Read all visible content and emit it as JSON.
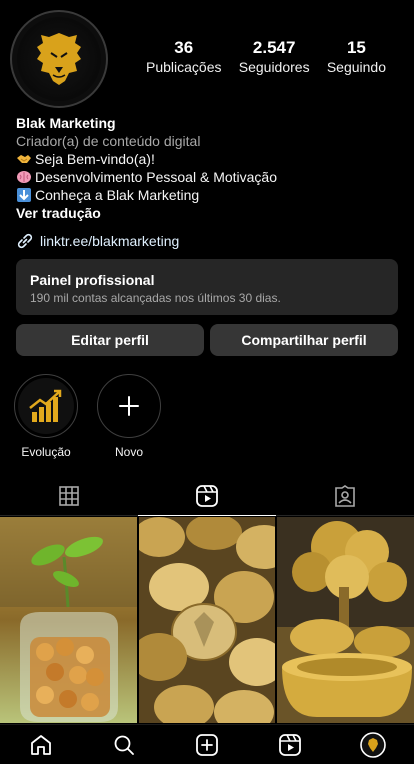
{
  "profile": {
    "stats": [
      {
        "value": "36",
        "label": "Publicações"
      },
      {
        "value": "2.547",
        "label": "Seguidores"
      },
      {
        "value": "15",
        "label": "Seguindo"
      }
    ]
  },
  "bio": {
    "name": "Blak Marketing",
    "category": "Criador(a) de conteúdo digital",
    "lines": [
      {
        "emoji": "handshake-emoji",
        "text": "Seja Bem-vindo(a)!"
      },
      {
        "emoji": "brain-emoji",
        "text": "Desenvolvimento Pessoal & Motivação"
      },
      {
        "emoji": "down-arrow-emoji",
        "text": "Conheça a Blak Marketing"
      }
    ],
    "translate": "Ver tradução",
    "link": "linktr.ee/blakmarketing"
  },
  "panel": {
    "title": "Painel profissional",
    "subtitle": "190 mil contas alcançadas nos últimos 30 dias."
  },
  "actions": {
    "edit": "Editar perfil",
    "share": "Compartilhar perfil"
  },
  "highlights": [
    {
      "label": "Evolução",
      "icon": "growth-chart-icon"
    },
    {
      "label": "Novo",
      "icon": "plus-icon"
    }
  ],
  "tabs": [
    "grid-icon",
    "reels-icon",
    "tagged-icon"
  ],
  "posts": [
    "plant-coins-jar",
    "gold-coins-pile",
    "money-tree-gold-pots"
  ],
  "nav": [
    "home-icon",
    "search-icon",
    "create-icon",
    "reels-icon",
    "profile-avatar"
  ],
  "colors": {
    "background": "#000000",
    "panel": "#262626",
    "button": "#363636",
    "gold": "#d4a017"
  }
}
